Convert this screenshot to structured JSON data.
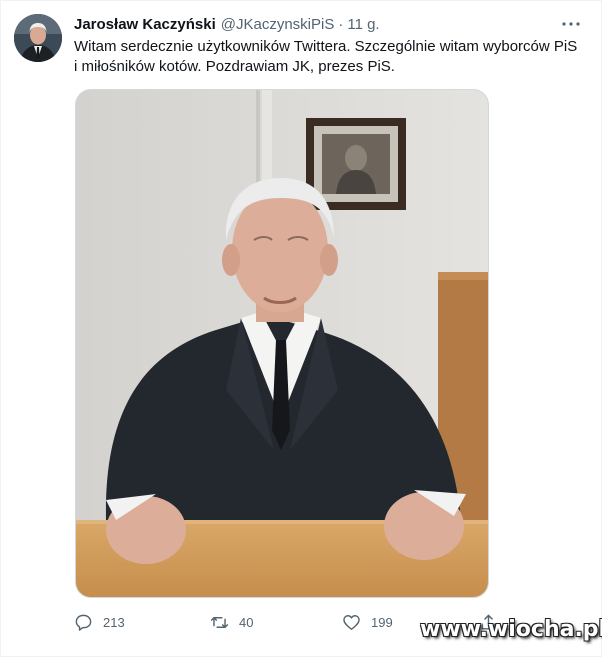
{
  "tweet": {
    "author": {
      "name": "Jarosław Kaczyński",
      "handle": "@JKaczynskiPiS",
      "separator": "·",
      "time": "11 g."
    },
    "more_icon": "more-dots-icon",
    "text": "Witam serdecznie użytkowników Twittera. Szczególnie witam wyborców PiS i miłośników kotów. Pozdrawiam JK, prezes PiS.",
    "media": {
      "type": "video-frame",
      "description_icon": "tweet-media-image"
    },
    "actions": {
      "reply": {
        "icon": "reply-icon",
        "count": "213"
      },
      "retweet": {
        "icon": "retweet-icon",
        "count": "40"
      },
      "like": {
        "icon": "like-icon",
        "count": "199"
      },
      "share": {
        "icon": "share-icon"
      }
    }
  },
  "watermark": "www.wiocha.pl",
  "colors": {
    "text_primary": "#0f1419",
    "text_secondary": "#536471",
    "border": "#cfd9de"
  }
}
